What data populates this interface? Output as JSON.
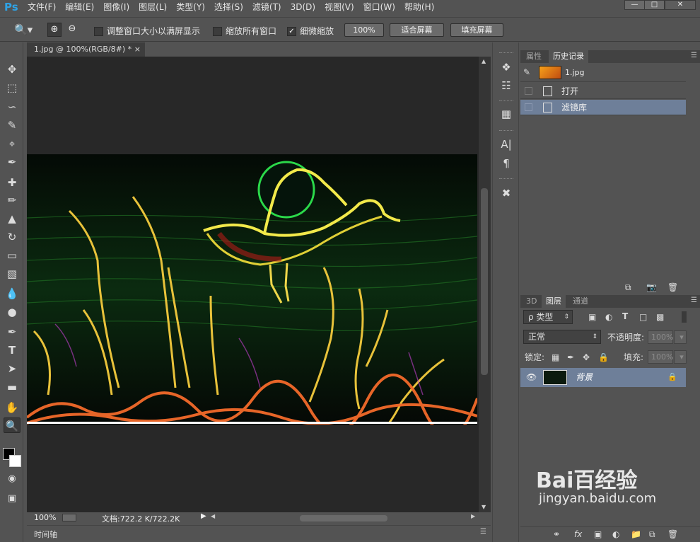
{
  "app": {
    "logo": "Ps",
    "accent": "#2fa3e5"
  },
  "menu": [
    "文件(F)",
    "编辑(E)",
    "图像(I)",
    "图层(L)",
    "类型(Y)",
    "选择(S)",
    "滤镜(T)",
    "3D(D)",
    "视图(V)",
    "窗口(W)",
    "帮助(H)"
  ],
  "window_controls": {
    "minimize": "—",
    "maximize": "□",
    "close": "✕"
  },
  "options": {
    "resize_windows": {
      "label": "调整窗口大小以满屏显示",
      "checked": false
    },
    "zoom_all": {
      "label": "缩放所有窗口",
      "checked": false
    },
    "scrubby_zoom": {
      "label": "细微缩放",
      "checked": true
    },
    "zoom_100": "100%",
    "fit_screen": "适合屏幕",
    "fill_screen": "填充屏幕"
  },
  "document": {
    "tab_title": "1.jpg @ 100%(RGB/8#) *",
    "tab_close": "×",
    "zoom": "100%",
    "doc_info": "文档:722.2 K/722.2K"
  },
  "timeline": {
    "label": "时间轴"
  },
  "history_panel": {
    "tabs": [
      "属性",
      "历史记录"
    ],
    "active_tab": 1,
    "snapshot": "1.jpg",
    "steps": [
      "打开",
      "滤镜库"
    ]
  },
  "layers_panel": {
    "tabs": [
      "3D",
      "图层",
      "通道"
    ],
    "active_tab": 1,
    "kind_filter": "ρ 类型",
    "blend_mode": "正常",
    "opacity_label": "不透明度:",
    "opacity_value": "100%",
    "lock_label": "锁定:",
    "fill_label": "填充:",
    "fill_value": "100%",
    "layer_name": "背景"
  },
  "watermark": {
    "text": "Bai百经验",
    "url": "jingyan.baidu.com"
  }
}
